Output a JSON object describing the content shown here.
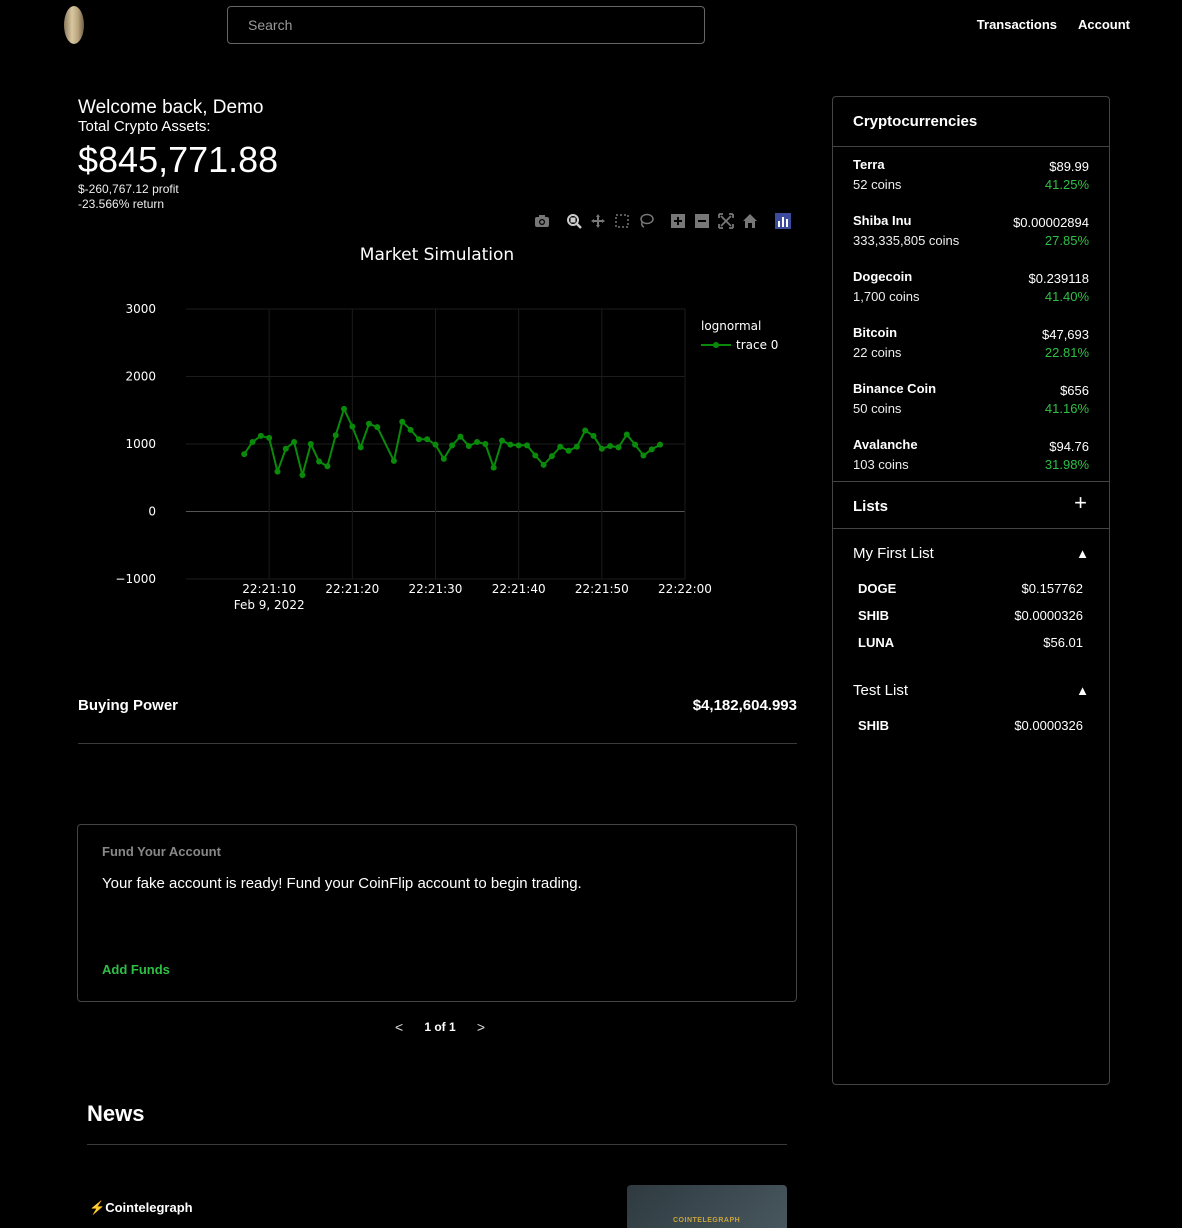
{
  "header": {
    "search_placeholder": "Search",
    "nav": [
      "Transactions",
      "Account"
    ]
  },
  "welcome": {
    "greeting": "Welcome back, Demo",
    "assets_label": "Total Crypto Assets:",
    "total": "$845,771.88",
    "profit": "$-260,767.12 profit",
    "return": "-23.566% return"
  },
  "modebar_icons": [
    "camera-icon",
    "zoom-icon",
    "pan-icon",
    "box-select-icon",
    "lasso-select-icon",
    "zoom-in-icon",
    "zoom-out-icon",
    "autoscale-icon",
    "reset-axes-icon",
    "plotly-logo-icon"
  ],
  "chart_data": {
    "type": "line",
    "title": "Market Simulation",
    "legend_title": "lognormal",
    "legend_position": "top-right",
    "series": [
      {
        "name": "trace 0",
        "color": "#0a8a0a",
        "x": [
          "22:21:07",
          "22:21:08",
          "22:21:09",
          "22:21:10",
          "22:21:11",
          "22:21:12",
          "22:21:13",
          "22:21:14",
          "22:21:15",
          "22:21:16",
          "22:21:17",
          "22:21:18",
          "22:21:19",
          "22:21:20",
          "22:21:21",
          "22:21:22",
          "22:21:23",
          "22:21:25",
          "22:21:26",
          "22:21:27",
          "22:21:28",
          "22:21:29",
          "22:21:30",
          "22:21:31",
          "22:21:32",
          "22:21:33",
          "22:21:34",
          "22:21:35",
          "22:21:36",
          "22:21:37",
          "22:21:38",
          "22:21:39",
          "22:21:40",
          "22:21:41",
          "22:21:42",
          "22:21:43",
          "22:21:44",
          "22:21:45",
          "22:21:46",
          "22:21:47",
          "22:21:48",
          "22:21:49",
          "22:21:50",
          "22:21:51",
          "22:21:52",
          "22:21:53",
          "22:21:54",
          "22:21:55",
          "22:21:56",
          "22:21:57"
        ],
        "y": [
          850,
          1030,
          1120,
          1090,
          590,
          930,
          1030,
          540,
          1000,
          740,
          670,
          1130,
          1520,
          1260,
          950,
          1300,
          1250,
          750,
          1330,
          1210,
          1070,
          1070,
          990,
          780,
          980,
          1110,
          970,
          1030,
          1000,
          650,
          1050,
          990,
          980,
          980,
          830,
          690,
          820,
          960,
          900,
          960,
          1200,
          1120,
          930,
          970,
          950,
          1140,
          990,
          830,
          920,
          990
        ]
      }
    ],
    "x_ticks": [
      "22:21:10",
      "22:21:20",
      "22:21:30",
      "22:21:40",
      "22:21:50",
      "22:22:00"
    ],
    "x_date_label": "Feb 9, 2022",
    "x_range": [
      "22:21:00",
      "22:22:00"
    ],
    "y_ticks": [
      3000,
      2000,
      1000,
      0,
      -1000
    ],
    "y_tick_labels": [
      "3000",
      "2000",
      "1000",
      "0",
      "−1000"
    ],
    "ylim": [
      -1000,
      3000
    ],
    "grid": true
  },
  "buying_power": {
    "label": "Buying Power",
    "value": "$4,182,604.993"
  },
  "fund": {
    "title": "Fund Your Account",
    "message": "Your fake account is ready! Fund your CoinFlip account to begin trading.",
    "action": "Add Funds"
  },
  "pager": {
    "prev": "<",
    "label": "1 of 1",
    "next": ">"
  },
  "news": {
    "heading": "News",
    "source_icon": "⚡",
    "source": "Cointelegraph",
    "image_text": "COINTELEGRAPH"
  },
  "sidebar": {
    "title": "Cryptocurrencies",
    "coins": [
      {
        "name": "Terra",
        "qty": "52 coins",
        "price": "$89.99",
        "change": "41.25%"
      },
      {
        "name": "Shiba Inu",
        "qty": "333,335,805 coins",
        "price": "$0.00002894",
        "change": "27.85%"
      },
      {
        "name": "Dogecoin",
        "qty": "1,700 coins",
        "price": "$0.239118",
        "change": "41.40%"
      },
      {
        "name": "Bitcoin",
        "qty": "22 coins",
        "price": "$47,693",
        "change": "22.81%"
      },
      {
        "name": "Binance Coin",
        "qty": "50 coins",
        "price": "$656",
        "change": "41.16%"
      },
      {
        "name": "Avalanche",
        "qty": "103 coins",
        "price": "$94.76",
        "change": "31.98%"
      }
    ],
    "lists_title": "Lists",
    "lists_add": "+",
    "lists": [
      {
        "name": "My First List",
        "toggle": "▲",
        "items": [
          {
            "symbol": "DOGE",
            "price": "$0.157762"
          },
          {
            "symbol": "SHIB",
            "price": "$0.0000326"
          },
          {
            "symbol": "LUNA",
            "price": "$56.01"
          }
        ]
      },
      {
        "name": "Test List",
        "toggle": "▲",
        "items": [
          {
            "symbol": "SHIB",
            "price": "$0.0000326"
          }
        ]
      }
    ]
  }
}
